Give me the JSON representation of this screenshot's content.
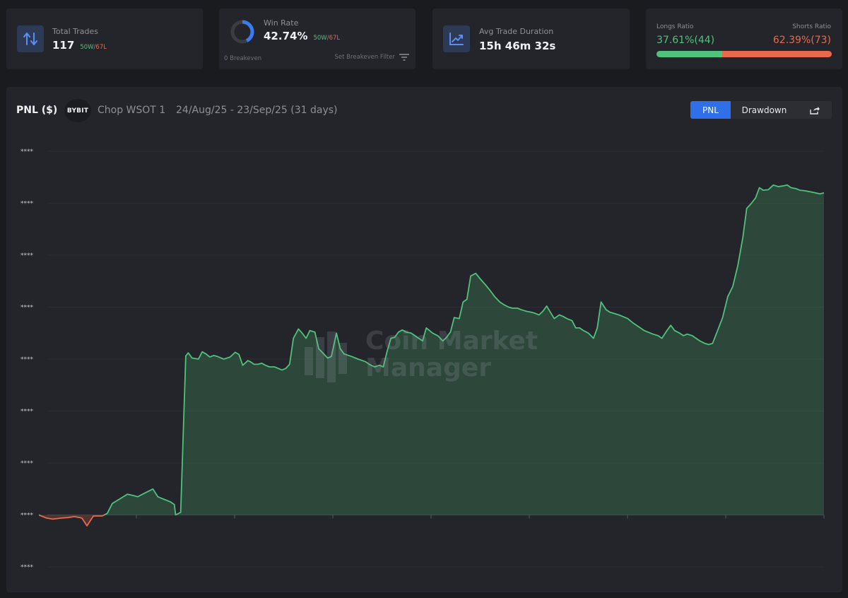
{
  "stats": {
    "total_trades": {
      "label": "Total Trades",
      "value": "117",
      "wins": "50W",
      "sep": "/",
      "losses": "67L"
    },
    "win_rate": {
      "label": "Win Rate",
      "value": "42.74%",
      "fraction": 0.4274,
      "wins": "50W",
      "sep": "/",
      "losses": "67L",
      "breakeven": "0 Breakeven",
      "filter_label": "Set Breakeven Filter"
    },
    "avg_duration": {
      "label": "Avg Trade Duration",
      "value": "15h 46m 32s"
    },
    "ratios": {
      "longs_label": "Longs Ratio",
      "longs_value": "37.61%(44)",
      "longs_fraction": 0.3761,
      "shorts_label": "Shorts Ratio",
      "shorts_value": "62.39%(73)"
    }
  },
  "chart_panel": {
    "title": "PNL ($)",
    "exchange_logo": "BYBIT",
    "account": "Chop WSOT 1",
    "date_range": "24/Aug/25 - 23/Sep/25 (31 days)",
    "toggle": {
      "pnl": "PNL",
      "drawdown": "Drawdown",
      "share_icon": "share-icon"
    }
  },
  "watermark": {
    "line1": "Coin Market",
    "line2": "Manager"
  },
  "colors": {
    "positive": "#4fc27c",
    "negative": "#e86a4c",
    "accent": "#2f6fe8"
  },
  "chart_data": {
    "type": "area",
    "title": "PNL ($)",
    "xlabel": "",
    "ylabel": "",
    "y_tick_labels": [
      "****",
      "****",
      "****",
      "****",
      "****",
      "****",
      "****",
      "****",
      "****"
    ],
    "zero_tick_index": 7,
    "ylim": [
      -1,
      7
    ],
    "grid": true,
    "x_ticks": 8,
    "x": [
      0,
      0.3,
      0.55,
      0.9,
      1.15,
      1.3,
      1.4,
      1.7,
      1.9,
      2.15,
      2.5,
      2.7,
      2.9,
      3.3,
      3.5,
      3.75,
      3.9,
      4.1,
      4.3,
      4.5,
      4.7,
      4.95,
      5.2,
      5.35,
      5.4,
      5.6,
      5.8,
      5.9,
      6.05,
      6.3,
      6.45,
      6.6,
      6.75,
      6.9,
      7.05,
      7.3,
      7.55,
      7.75,
      7.9,
      8.05,
      8.25,
      8.35,
      8.5,
      8.65,
      8.8,
      8.95,
      9.1,
      9.3,
      9.45,
      9.6,
      9.75,
      9.9,
      10.05,
      10.25,
      10.4,
      10.55,
      10.7,
      10.9,
      11.05,
      11.25,
      11.4,
      11.55,
      11.75,
      11.9,
      12.05,
      12.35,
      12.6,
      12.9,
      13.05,
      13.25,
      13.45,
      13.6,
      13.75,
      13.9,
      14.05,
      14.2,
      14.35,
      14.5,
      14.7,
      14.85,
      15.0,
      15.15,
      15.3,
      15.55,
      15.75,
      15.95,
      16.1,
      16.25,
      16.4,
      16.6,
      16.75,
      16.9,
      17.05,
      17.25,
      17.45,
      17.65,
      17.85,
      18.0,
      18.2,
      18.35,
      18.55,
      18.7,
      18.9,
      19.05,
      19.25,
      19.45,
      19.6,
      19.75,
      19.9,
      20.05,
      20.2,
      20.35,
      20.55,
      20.7,
      20.85,
      21.05,
      21.2,
      21.35,
      21.5,
      21.7,
      21.9,
      22.05,
      22.2,
      22.4,
      22.55,
      22.7,
      22.9,
      23.05,
      23.25,
      23.45,
      23.6,
      23.75,
      23.9,
      24.05,
      24.25,
      24.45,
      24.6,
      24.8,
      24.95,
      25.1,
      25.3,
      25.45,
      25.6,
      25.8,
      25.95,
      26.1,
      26.3,
      26.45,
      26.6,
      26.8,
      27.0,
      27.2,
      27.4,
      27.6,
      27.8,
      27.95,
      28.1,
      28.3,
      28.45,
      28.6,
      28.8,
      29.0,
      29.2,
      29.35,
      29.55,
      29.7,
      29.9,
      30.05,
      30.25,
      30.45,
      30.65,
      30.85,
      31.0
    ],
    "series": [
      {
        "values": [
          0,
          -0.06,
          -0.08,
          -0.06,
          -0.05,
          -0.04,
          -0.03,
          -0.06,
          -0.21,
          -0.02,
          -0.02,
          0.03,
          0.22,
          0.34,
          0.4,
          0.37,
          0.35,
          0.4,
          0.45,
          0.5,
          0.35,
          0.3,
          0.25,
          0.2,
          0.0,
          0.05,
          3.06,
          3.12,
          3.02,
          3.0,
          3.14,
          3.1,
          3.04,
          3.07,
          3.05,
          3.0,
          3.04,
          3.13,
          3.09,
          2.88,
          2.97,
          2.95,
          2.9,
          2.9,
          2.92,
          2.88,
          2.85,
          2.85,
          2.82,
          2.79,
          2.82,
          2.9,
          3.4,
          3.58,
          3.5,
          3.4,
          3.55,
          3.52,
          3.2,
          3.1,
          3.02,
          3.05,
          3.5,
          3.2,
          3.1,
          3.05,
          3.0,
          2.95,
          2.9,
          2.85,
          2.88,
          2.85,
          3.15,
          3.4,
          3.42,
          3.52,
          3.56,
          3.52,
          3.5,
          3.45,
          3.4,
          3.35,
          3.6,
          3.5,
          3.45,
          3.35,
          3.42,
          3.52,
          3.8,
          3.78,
          4.1,
          4.15,
          4.6,
          4.65,
          4.53,
          4.42,
          4.3,
          4.2,
          4.1,
          4.05,
          4.0,
          3.98,
          3.98,
          3.95,
          3.92,
          3.9,
          3.88,
          3.85,
          3.92,
          4.02,
          3.9,
          3.78,
          3.85,
          3.82,
          3.78,
          3.74,
          3.6,
          3.6,
          3.55,
          3.5,
          3.4,
          3.6,
          4.1,
          3.95,
          3.9,
          3.88,
          3.85,
          3.82,
          3.78,
          3.7,
          3.65,
          3.6,
          3.55,
          3.52,
          3.48,
          3.45,
          3.4,
          3.55,
          3.65,
          3.55,
          3.5,
          3.45,
          3.48,
          3.45,
          3.4,
          3.35,
          3.3,
          3.28,
          3.3,
          3.55,
          3.8,
          4.2,
          4.4,
          4.8,
          5.35,
          5.9,
          5.98,
          6.1,
          6.3,
          6.25,
          6.26,
          6.35,
          6.32,
          6.33,
          6.35,
          6.3,
          6.28,
          6.25,
          6.24,
          6.22,
          6.2,
          6.18,
          6.2,
          6.22,
          6.25
        ]
      }
    ]
  }
}
